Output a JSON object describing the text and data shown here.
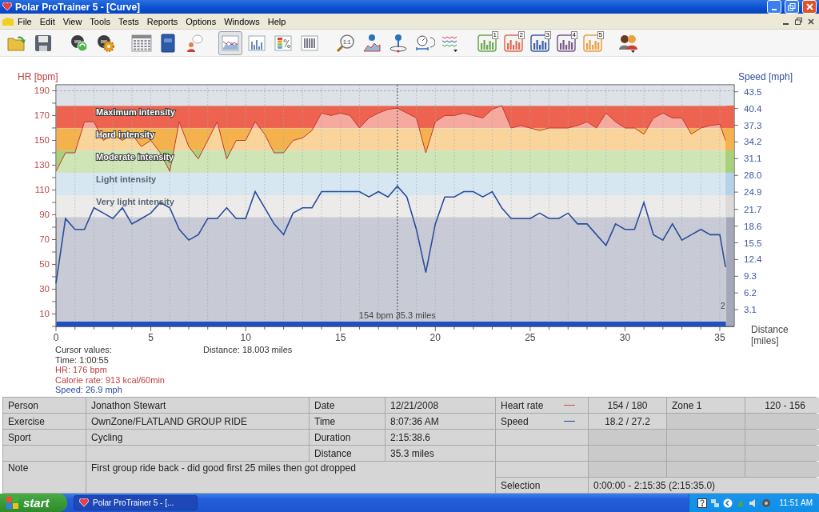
{
  "window": {
    "title": "Polar ProTrainer 5 - [Curve]"
  },
  "menu": [
    "File",
    "Edit",
    "View",
    "Tools",
    "Tests",
    "Reports",
    "Options",
    "Windows",
    "Help"
  ],
  "toolbar": [
    {
      "kind": "open"
    },
    {
      "kind": "save"
    },
    {
      "kind": "spacer"
    },
    {
      "kind": "device-sync"
    },
    {
      "kind": "device-settings"
    },
    {
      "kind": "spacer"
    },
    {
      "kind": "calendar"
    },
    {
      "kind": "book"
    },
    {
      "kind": "person-chat"
    },
    {
      "kind": "spacer"
    },
    {
      "kind": "view-curve",
      "selected": true
    },
    {
      "kind": "view-bars",
      "selected": false
    },
    {
      "kind": "view-zones",
      "selected": false
    },
    {
      "kind": "view-table",
      "selected": false
    },
    {
      "kind": "spacer"
    },
    {
      "kind": "zoom",
      "label": "1:1"
    },
    {
      "kind": "info-curve"
    },
    {
      "kind": "info-lap"
    },
    {
      "kind": "stopwatch"
    },
    {
      "kind": "multi-curve"
    },
    {
      "kind": "spacer"
    },
    {
      "kind": "sample",
      "label": "1",
      "color": "#6aa84f"
    },
    {
      "kind": "sample",
      "label": "2",
      "color": "#e06a50"
    },
    {
      "kind": "sample",
      "label": "3",
      "color": "#3c5fa8"
    },
    {
      "kind": "sample",
      "label": "4",
      "color": "#7a5a8a"
    },
    {
      "kind": "sample",
      "label": "5",
      "color": "#e8a040"
    },
    {
      "kind": "spacer"
    },
    {
      "kind": "people"
    }
  ],
  "chart": {
    "lap_marker": "2",
    "cursor_label": "154 bpm 35.3 miles",
    "chart_data": {
      "type": "line",
      "xlabel": "Distance [miles]",
      "ylabel": "HR [bpm]",
      "xlim": [
        0,
        35.76
      ],
      "ylim": [
        0,
        194.8
      ],
      "xticks": [
        0,
        5,
        10,
        15,
        20,
        25,
        30,
        35
      ],
      "yticks": [
        10,
        30,
        50,
        70,
        90,
        110,
        130,
        150,
        170,
        190
      ],
      "grid": true,
      "bands": [
        {
          "axis": "y",
          "from": 178,
          "to": 194.8,
          "color": "#dde1e8"
        },
        {
          "axis": "y",
          "from": 160,
          "to": 178,
          "color": "#ee6350",
          "label": "Maximum intensity"
        },
        {
          "axis": "y",
          "from": 142,
          "to": 160,
          "color": "#f5b24c",
          "label": "Hard intensity"
        },
        {
          "axis": "y",
          "from": 124,
          "to": 142,
          "color": "#a9d07a",
          "label": "Moderate intensity"
        },
        {
          "axis": "y",
          "from": 106,
          "to": 124,
          "color": "#b4d3e8",
          "label": "Light intensity"
        },
        {
          "axis": "y",
          "from": 88,
          "to": 106,
          "color": "#dcdad8",
          "label": "Very light intensity"
        }
      ],
      "ref_lines": [
        {
          "axis": "x",
          "value": 18.0,
          "color": "#333333"
        },
        {
          "axis": "y",
          "value": 190,
          "color": "#888888"
        }
      ],
      "x": [
        0,
        0.5,
        1,
        1.5,
        2,
        2.5,
        3,
        3.5,
        4,
        4.5,
        5,
        5.5,
        6,
        6.5,
        7,
        7.5,
        8,
        8.5,
        9,
        9.5,
        10,
        10.5,
        11,
        11.5,
        12,
        12.5,
        13,
        13.5,
        14,
        14.5,
        15,
        15.5,
        16,
        16.5,
        17,
        17.5,
        18,
        18.5,
        19,
        19.5,
        20,
        20.5,
        21,
        21.5,
        22,
        22.5,
        23,
        23.5,
        24,
        24.5,
        25,
        25.5,
        26,
        26.5,
        27,
        27.5,
        28,
        28.5,
        29,
        29.5,
        30,
        30.5,
        31,
        31.5,
        32,
        32.5,
        33,
        33.5,
        34,
        34.5,
        35,
        35.3
      ],
      "series": [
        {
          "color": "#c0392b",
          "values": [
            125,
            140,
            140,
            165,
            165,
            150,
            155,
            150,
            155,
            145,
            150,
            140,
            125,
            165,
            145,
            135,
            150,
            165,
            135,
            150,
            150,
            165,
            155,
            140,
            140,
            150,
            152,
            158,
            172,
            170,
            172,
            170,
            160,
            168,
            172,
            175,
            176,
            172,
            168,
            140,
            165,
            170,
            170,
            172,
            170,
            168,
            175,
            178,
            160,
            162,
            160,
            158,
            160,
            160,
            160,
            162,
            165,
            160,
            172,
            165,
            160,
            160,
            155,
            168,
            172,
            168,
            168,
            155,
            160,
            162,
            163,
            150
          ]
        }
      ]
    }
  },
  "speed_chart": {
    "chart_data": {
      "type": "line",
      "ylabel": "Speed [mph]",
      "ylim": [
        0,
        44.8
      ],
      "yticks": [
        43.5,
        40.4,
        37.3,
        34.2,
        31.1,
        {
          "value": 28,
          "label": "28.0"
        },
        24.9,
        21.7,
        18.6,
        15.5,
        12.4,
        9.3,
        6.2,
        3.1
      ],
      "series": [
        {
          "color": "#2a4d9c",
          "values": [
            8,
            20,
            18,
            18,
            22,
            21,
            20,
            22,
            19,
            20,
            21,
            23,
            22,
            18,
            16,
            17,
            20,
            20,
            22,
            20,
            20,
            25,
            22,
            19,
            17,
            21,
            22,
            22,
            25,
            25,
            25,
            25,
            25,
            24,
            25,
            24,
            26,
            24,
            18,
            10,
            19,
            24,
            24,
            25,
            25,
            24,
            25,
            22,
            20,
            20,
            20,
            21,
            20,
            20,
            21,
            19,
            19,
            17,
            15,
            19,
            18,
            18,
            23,
            17,
            16,
            19,
            16,
            17,
            18,
            17,
            17,
            11
          ]
        }
      ]
    }
  },
  "cursor_values": {
    "title": "Cursor values:",
    "time": "Time: 1:00:55",
    "hr": "HR: 176 bpm",
    "calorie": "Calorie rate: 913 kcal/60min",
    "speed": "Speed: 26.9 mph",
    "distance": "Distance: 18.003 miles"
  },
  "details": [
    {
      "label": "Person",
      "value": "Jonathon Stewart",
      "label_2": "Date",
      "value_2": "12/21/2008"
    },
    {
      "label": "Exercise",
      "value": "OwnZone/FLATLAND GROUP RIDE",
      "label_2": "Time",
      "value_2": "8:07:36 AM"
    },
    {
      "label": "Sport",
      "value": "Cycling",
      "label_2": "Duration",
      "value_2": "2:15:38.6"
    },
    {
      "label_2": "Distance",
      "value_2": "35.3 miles"
    }
  ],
  "note": {
    "label": "Note",
    "text": "First group ride back - did good first 25 miles then got dropped"
  },
  "summary": [
    {
      "label": "Heart rate",
      "color": "#d04a4a",
      "value": "154 / 180",
      "zone": "Zone 1",
      "range": "120 - 156"
    },
    {
      "label": "Speed",
      "color": "#2040a0",
      "value": "18.2 / 27.2"
    }
  ],
  "selection": {
    "label": "Selection",
    "value": "0:00:00 - 2:15:35 (2:15:35.0)"
  },
  "taskbar": {
    "start": "start",
    "task": "Polar ProTrainer 5 - [...",
    "clock": "11:51 AM"
  }
}
